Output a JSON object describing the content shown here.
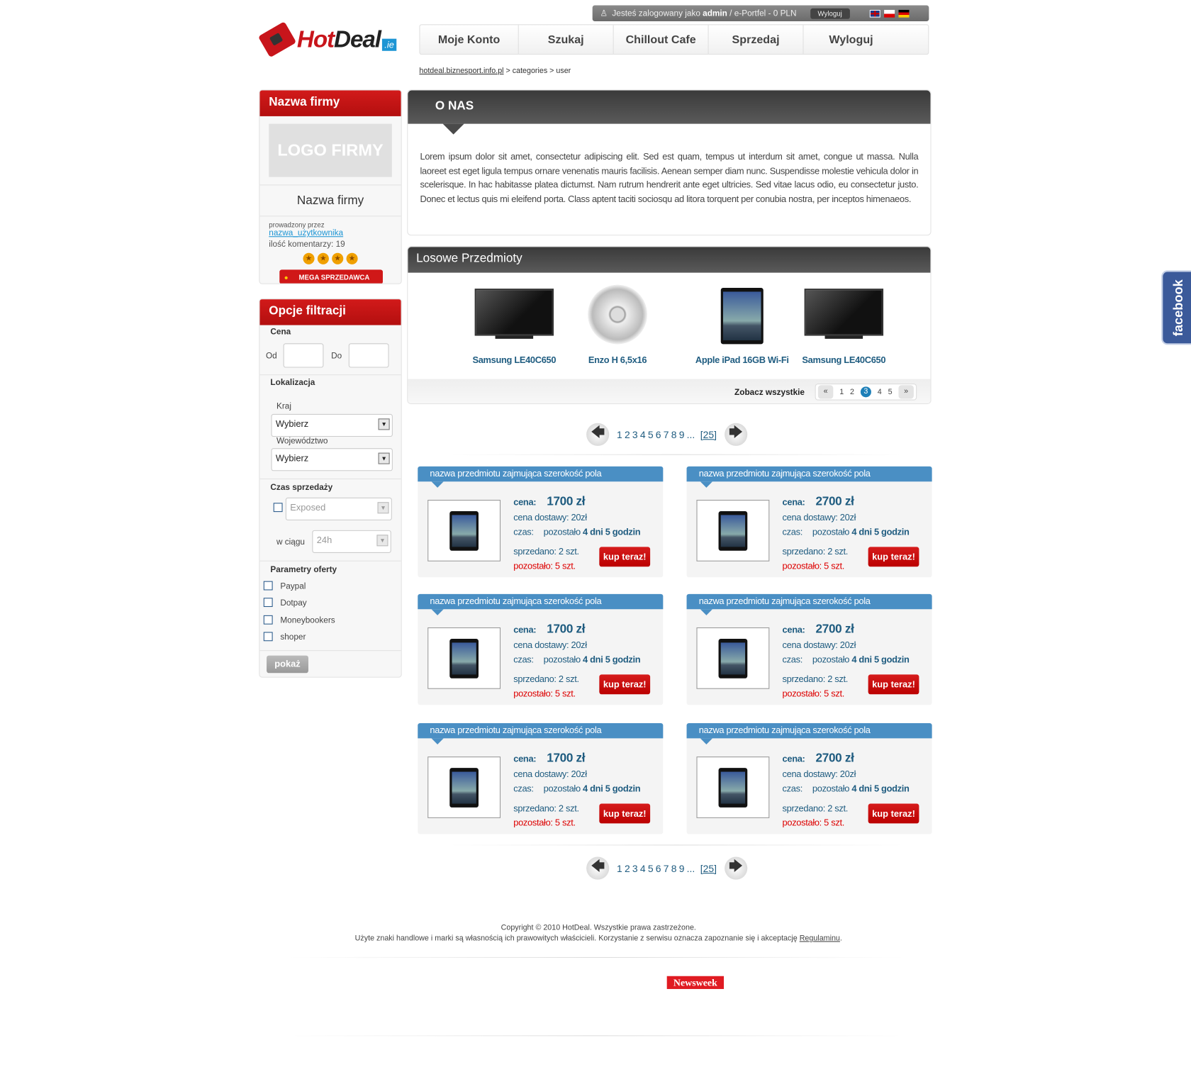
{
  "topbar": {
    "prefix": "Jesteś zalogowany jako",
    "user": "admin",
    "suffix": "/ e-Portfel - 0 PLN",
    "logout": "Wyloguj",
    "flags": [
      "en",
      "pl",
      "de"
    ]
  },
  "logo": {
    "hot": "Hot",
    "deal": "Deal",
    "tld": ".ie"
  },
  "nav": [
    {
      "label": "Moje Konto"
    },
    {
      "label": "Szukaj"
    },
    {
      "label": "Chillout Cafe"
    },
    {
      "label": "Sprzedaj"
    },
    {
      "label": "Wyloguj"
    }
  ],
  "breadcrumb": {
    "home": "hotdeal.biznesport.info.pl",
    "rest": " > categories > user"
  },
  "company": {
    "header": "Nazwa firmy",
    "logo_text": "LOGO FIRMY",
    "name": "Nazwa firmy",
    "run_by": "prowadzony przez",
    "user_link": "nazwa_użytkownika",
    "comments": "ilość komentarzy: 19",
    "stars": 4,
    "badge": "MEGA SPRZEDAWCA"
  },
  "filters": {
    "header": "Opcje filtracji",
    "price": "Cena",
    "from": "Od",
    "to": "Do",
    "location": "Lokalizacja",
    "country": "Kraj",
    "country_value": "Wybierz",
    "region": "Województwo",
    "region_value": "Wybierz",
    "time": "Czas sprzedaży",
    "time_value": "Exposed",
    "within": "w ciągu",
    "within_value": "24h",
    "params": "Parametry oferty",
    "options": [
      "Paypal",
      "Dotpay",
      "Moneybookers",
      "shoper"
    ],
    "submit": "pokaż"
  },
  "about": {
    "title": "O NAS",
    "text": "Lorem ipsum dolor sit amet, consectetur adipiscing elit. Sed est quam, tempus ut interdum sit amet, congue ut massa. Nulla laoreet est eget ligula tempus ornare venenatis mauris facilisis. Aenean semper diam nunc. Suspendisse molestie vehicula dolor in scelerisque. In hac habitasse platea dictumst. Nam rutrum hendrerit ante eget ultricies. Sed vitae lacus odio, eu consectetur justo. Donec et lectus quis mi eleifend porta. Class aptent taciti sociosqu ad litora torquent per conubia nostra, per inceptos himenaeos."
  },
  "random": {
    "title": "Losowe Przedmioty",
    "items": [
      {
        "name": "Samsung LE40C650",
        "icon": "tv"
      },
      {
        "name": "Enzo H 6,5x16",
        "icon": "wheel"
      },
      {
        "name": "Apple iPad 16GB Wi-Fi",
        "icon": "tablet"
      },
      {
        "name": "Samsung LE40C650",
        "icon": "tv"
      }
    ],
    "see_all": "Zobacz wszystkie",
    "prev": "«",
    "next": "»",
    "pages": [
      "1",
      "2",
      "3",
      "4",
      "5"
    ],
    "current": "3"
  },
  "pagination": {
    "pages": [
      "1",
      "2",
      "3",
      "4",
      "5",
      "6",
      "7",
      "8",
      "9"
    ],
    "ellipsis": "...",
    "last": "[25]"
  },
  "products": [
    {
      "title": "nazwa przedmiotu zajmująca szerokość pola",
      "price_label": "cena:",
      "price": "1700 zł",
      "shipping": "cena dostawy: 20zł",
      "time_label": "czas:",
      "time_prefix": "pozostało",
      "time_value": "4 dni 5 godzin",
      "sold": "sprzedano: 2 szt.",
      "left": "pozostało: 5 szt.",
      "buy": "kup teraz!"
    },
    {
      "title": "nazwa przedmiotu zajmująca szerokość pola",
      "price_label": "cena:",
      "price": "2700 zł",
      "shipping": "cena dostawy: 20zł",
      "time_label": "czas:",
      "time_prefix": "pozostało",
      "time_value": "4 dni 5 godzin",
      "sold": "sprzedano: 2 szt.",
      "left": "pozostało: 5 szt.",
      "buy": "kup teraz!"
    },
    {
      "title": "nazwa przedmiotu zajmująca szerokość pola",
      "price_label": "cena:",
      "price": "1700 zł",
      "shipping": "cena dostawy: 20zł",
      "time_label": "czas:",
      "time_prefix": "pozostało",
      "time_value": "4 dni 5 godzin",
      "sold": "sprzedano: 2 szt.",
      "left": "pozostało: 5 szt.",
      "buy": "kup teraz!"
    },
    {
      "title": "nazwa przedmiotu zajmująca szerokość pola",
      "price_label": "cena:",
      "price": "2700 zł",
      "shipping": "cena dostawy: 20zł",
      "time_label": "czas:",
      "time_prefix": "pozostało",
      "time_value": "4 dni 5 godzin",
      "sold": "sprzedano: 2 szt.",
      "left": "pozostało: 5 szt.",
      "buy": "kup teraz!"
    },
    {
      "title": "nazwa przedmiotu zajmująca szerokość pola",
      "price_label": "cena:",
      "price": "1700 zł",
      "shipping": "cena dostawy: 20zł",
      "time_label": "czas:",
      "time_prefix": "pozostało",
      "time_value": "4 dni 5 godzin",
      "sold": "sprzedano: 2 szt.",
      "left": "pozostało: 5 szt.",
      "buy": "kup teraz!"
    },
    {
      "title": "nazwa przedmiotu zajmująca szerokość pola",
      "price_label": "cena:",
      "price": "2700 zł",
      "shipping": "cena dostawy: 20zł",
      "time_label": "czas:",
      "time_prefix": "pozostało",
      "time_value": "4 dni 5 godzin",
      "sold": "sprzedano: 2 szt.",
      "left": "pozostało: 5 szt.",
      "buy": "kup teraz!"
    }
  ],
  "footer": {
    "copyright": "Copyright © 2010 HotDeal. Wszystkie prawa zastrzeżone.",
    "trademark": "Użyte znaki handlowe i marki są własnością ich prawowitych właścicieli. Korzystanie z serwisu oznacza zapoznanie się i akceptację ",
    "terms": "Regulaminu",
    "period": ".",
    "partner": "Newsweek"
  },
  "facebook": "facebook",
  "colors": {
    "red": "#c8151b",
    "blue": "#4a8fc4",
    "text_blue": "#1f5c80"
  }
}
